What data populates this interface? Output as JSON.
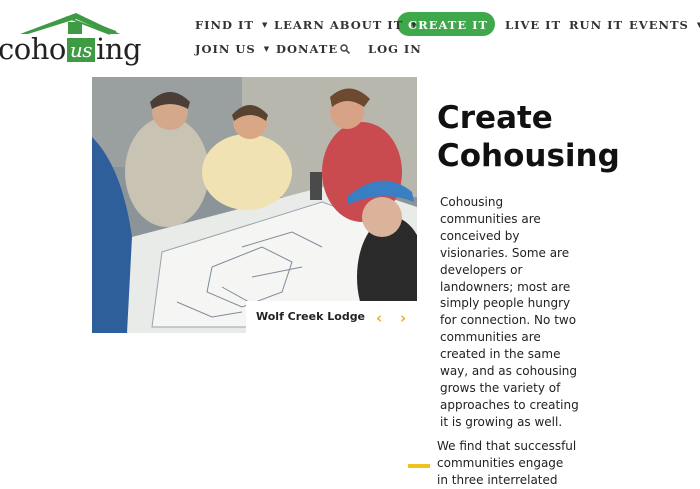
{
  "logo": {
    "text_pre": "coho",
    "text_us": "us",
    "text_post": "ing"
  },
  "nav": {
    "row1": [
      {
        "label": "FIND IT",
        "caret": "▼"
      },
      {
        "label": "LEARN ABOUT IT",
        "caret": "▼"
      },
      {
        "label": "CREATE IT",
        "caret": "▼",
        "active": true
      },
      {
        "label": "LIVE IT"
      },
      {
        "label": "RUN IT"
      },
      {
        "label": "EVENTS",
        "caret": "▼"
      }
    ],
    "row2": [
      {
        "label": "JOIN US",
        "caret": "▼"
      },
      {
        "label": "DONATE"
      },
      {
        "label": "LOG IN"
      }
    ],
    "search_icon": "search-icon"
  },
  "slideshow": {
    "caption": "Wolf Creek Lodge",
    "prev": "‹",
    "next": "›"
  },
  "content": {
    "heading_line1": "Create",
    "heading_line2": "Cohousing",
    "paragraph1": "Cohousing communities are conceived by visionaries. Some are developers or landowners; most are simply people hungry for connection. No two communities are created in the same way, and as cohousing grows the variety of approaches to creating it is growing as well.",
    "paragraph2": "We find that successful communities engage in three interrelated"
  },
  "colors": {
    "brand_green": "#3fa84a",
    "accent_yellow": "#e8b21c"
  }
}
